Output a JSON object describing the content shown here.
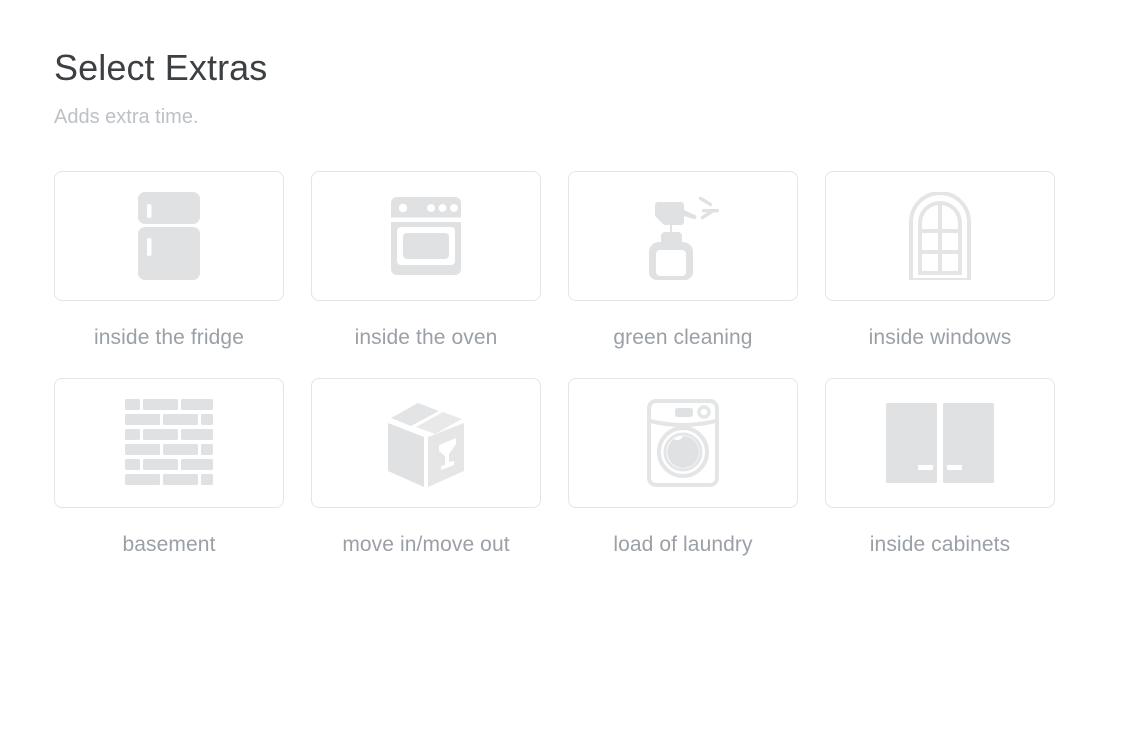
{
  "header": {
    "title": "Select Extras",
    "subtitle": "Adds extra time."
  },
  "theme": {
    "page_background": "#ffffff",
    "title_color": "#3c4043",
    "subtitle_color": "#bdc1c6",
    "label_color": "#9aa0a6",
    "card_border_color": "#e4e5e6",
    "icon_fill_color": "#e0e1e2"
  },
  "extras": {
    "columns": 4,
    "rows": 2,
    "items": [
      {
        "id": "inside-the-fridge",
        "label": "inside the fridge",
        "icon": "fridge-icon",
        "selected": false
      },
      {
        "id": "inside-the-oven",
        "label": "inside the oven",
        "icon": "oven-icon",
        "selected": false
      },
      {
        "id": "green-cleaning",
        "label": "green cleaning",
        "icon": "spray-bottle-icon",
        "selected": false
      },
      {
        "id": "inside-windows",
        "label": "inside windows",
        "icon": "window-icon",
        "selected": false
      },
      {
        "id": "basement",
        "label": "basement",
        "icon": "brick-wall-icon",
        "selected": false
      },
      {
        "id": "move-in-move-out",
        "label": "move in/move out",
        "icon": "moving-box-icon",
        "selected": false
      },
      {
        "id": "load-of-laundry",
        "label": "load of laundry",
        "icon": "washing-machine-icon",
        "selected": false
      },
      {
        "id": "inside-cabinets",
        "label": "inside cabinets",
        "icon": "cabinets-icon",
        "selected": false
      }
    ]
  }
}
